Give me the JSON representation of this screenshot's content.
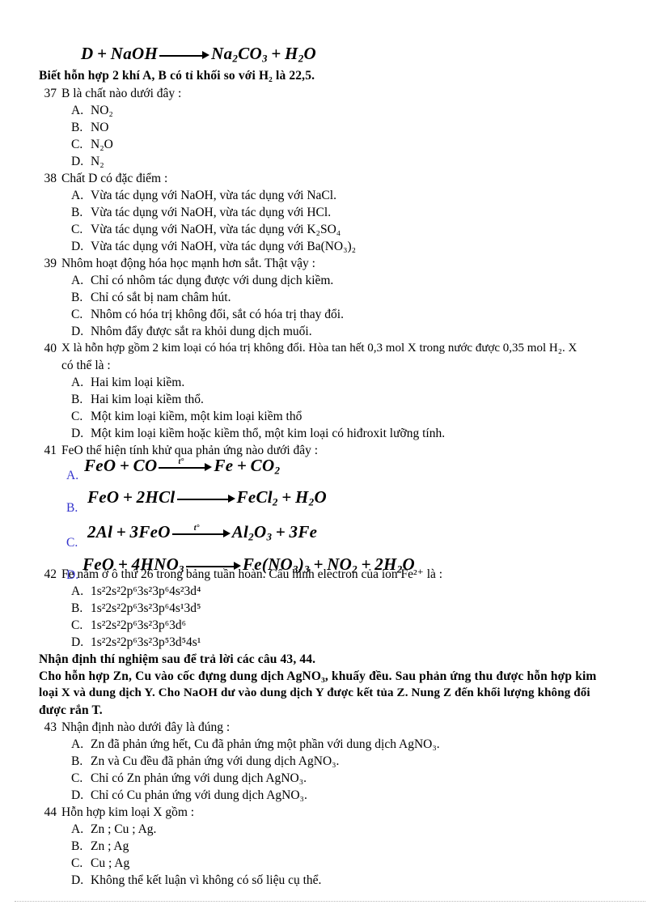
{
  "document": {
    "header_equation": {
      "lhs": "D + NaOH",
      "rhs_parts": [
        "Na",
        "2",
        "CO",
        "3",
        " + H",
        "2",
        "O"
      ],
      "condition": ""
    },
    "intro_note": "Biết hỗn hợp 2 khí A, B có tỉ khối so với H₂ là 22,5."
  },
  "questions": [
    {
      "number": "37",
      "stem": "B là chất nào dưới đây :",
      "options": [
        {
          "letter": "A.",
          "text": "NO₂"
        },
        {
          "letter": "B.",
          "text": "NO"
        },
        {
          "letter": "C.",
          "text": "N₂O"
        },
        {
          "letter": "D.",
          "text": "N₂"
        }
      ]
    },
    {
      "number": "38",
      "stem": "Chất D có đặc điểm :",
      "options": [
        {
          "letter": "A.",
          "text": "Vừa tác dụng với NaOH, vừa tác dụng với NaCl."
        },
        {
          "letter": "B.",
          "text": "Vừa tác dụng với NaOH, vừa tác dụng với HCl."
        },
        {
          "letter": "C.",
          "text": "Vừa tác dụng với NaOH, vừa tác dụng với K₂SO₄"
        },
        {
          "letter": "D.",
          "text": "Vừa tác dụng với NaOH, vừa tác dụng với Ba(NO₃)₂"
        }
      ]
    },
    {
      "number": "39",
      "stem": "Nhôm hoạt động hóa học mạnh hơn sắt. Thật vậy :",
      "options": [
        {
          "letter": "A.",
          "text": "Chỉ có nhôm tác dụng được với dung dịch kiềm."
        },
        {
          "letter": "B.",
          "text": "Chỉ có sắt bị nam châm hút."
        },
        {
          "letter": "C.",
          "text": "Nhôm có hóa trị không đổi, sắt có hóa trị thay đổi."
        },
        {
          "letter": "D.",
          "text": "Nhôm đẩy được sắt ra khỏi dung dịch muối."
        }
      ]
    },
    {
      "number": "40",
      "stem_line1": "X là hỗn hợp gồm 2 kim loại có hóa trị không đổi. Hòa tan hết 0,3 mol X trong nước được 0,35 mol H₂. X",
      "stem_line2": "có thể là :",
      "options": [
        {
          "letter": "A.",
          "text": "Hai kim loại kiềm."
        },
        {
          "letter": "B.",
          "text": "Hai kim loại kiềm thổ."
        },
        {
          "letter": "C.",
          "text": "Một kim loại kiềm, một kim loại kiềm thổ"
        },
        {
          "letter": "D.",
          "text": "Một kim loại kiềm hoặc kiềm thổ, một kim loại có hiđroxit lưỡng tính."
        }
      ]
    },
    {
      "number": "41",
      "stem": "FeO thể hiện tính khử qua phản ứng nào dưới đây :",
      "equation_options": [
        {
          "letter": "A.",
          "condition": "t°",
          "has_condition": true
        },
        {
          "letter": "B.",
          "condition": "",
          "has_condition": false
        },
        {
          "letter": "C.",
          "condition": "t°",
          "has_condition": true
        },
        {
          "letter": "D.",
          "condition": "",
          "has_condition": false
        }
      ]
    },
    {
      "number": "42",
      "stem": "Fe nằm ở ô thứ 26 trong bảng tuần hoàn. Cấu hình electron của ion Fe²⁺ là :",
      "options": [
        {
          "letter": "A.",
          "text": "1s²2s²2p⁶3s²3p⁶4s²3d⁴"
        },
        {
          "letter": "B.",
          "text": "1s²2s²2p⁶3s²3p⁶4s¹3d⁵"
        },
        {
          "letter": "C.",
          "text": "1s²2s²2p⁶3s²3p⁶3d⁶"
        },
        {
          "letter": "D.",
          "text": "1s²2s²2p⁶3s²3p⁵3d⁵4s¹"
        }
      ]
    },
    {
      "number": "43",
      "stem": "Nhận định nào dưới đây là đúng :",
      "options": [
        {
          "letter": "A.",
          "text": "Zn đã phản ứng hết, Cu đã phản ứng một phần với dung dịch AgNO₃."
        },
        {
          "letter": "B.",
          "text": "Zn và Cu đều đã phản ứng với dung dịch AgNO₃."
        },
        {
          "letter": "C.",
          "text": "Chỉ có Zn phản ứng với dung dịch AgNO₃."
        },
        {
          "letter": "D.",
          "text": "Chỉ có Cu phản ứng với dung dịch AgNO₃."
        }
      ]
    },
    {
      "number": "44",
      "stem": "Hỗn hợp kim loại X gồm :",
      "options": [
        {
          "letter": "A.",
          "text": "Zn ; Cu ; Ag."
        },
        {
          "letter": "B.",
          "text": "Zn ; Ag"
        },
        {
          "letter": "C.",
          "text": "Cu ; Ag"
        },
        {
          "letter": "D.",
          "text": "Không thể kết luận vì không có số liệu cụ thể."
        }
      ]
    }
  ],
  "passage": {
    "heading": "Nhận định thí nghiệm sau để trả lời các câu 43, 44.",
    "line1": "Cho hỗn hợp Zn, Cu vào cốc đựng dung dịch AgNO₃, khuấy đều. Sau phản ứng thu được hỗn hợp kim",
    "line2": "loại X và dung dịch Y. Cho NaOH dư vào dung dịch Y được kết tủa Z. Nung Z đến khối lượng không đổi",
    "line3": "được rắn T."
  },
  "equations": {
    "q41_a": "FeO + CO → Fe + CO₂",
    "q41_b": "FeO + 2HCl → FeCl₂ + H₂O",
    "q41_c": "2Al + 3FeO → Al₂O₃ + 3Fe",
    "q41_d": "FeO + 4HNO₃ → Fe(NO₃)₃ + NO₂ + 2H₂O"
  },
  "colors": {
    "text": "#000000",
    "option_letter_blue": "#3333cc",
    "rule": "#b9b9b9"
  }
}
